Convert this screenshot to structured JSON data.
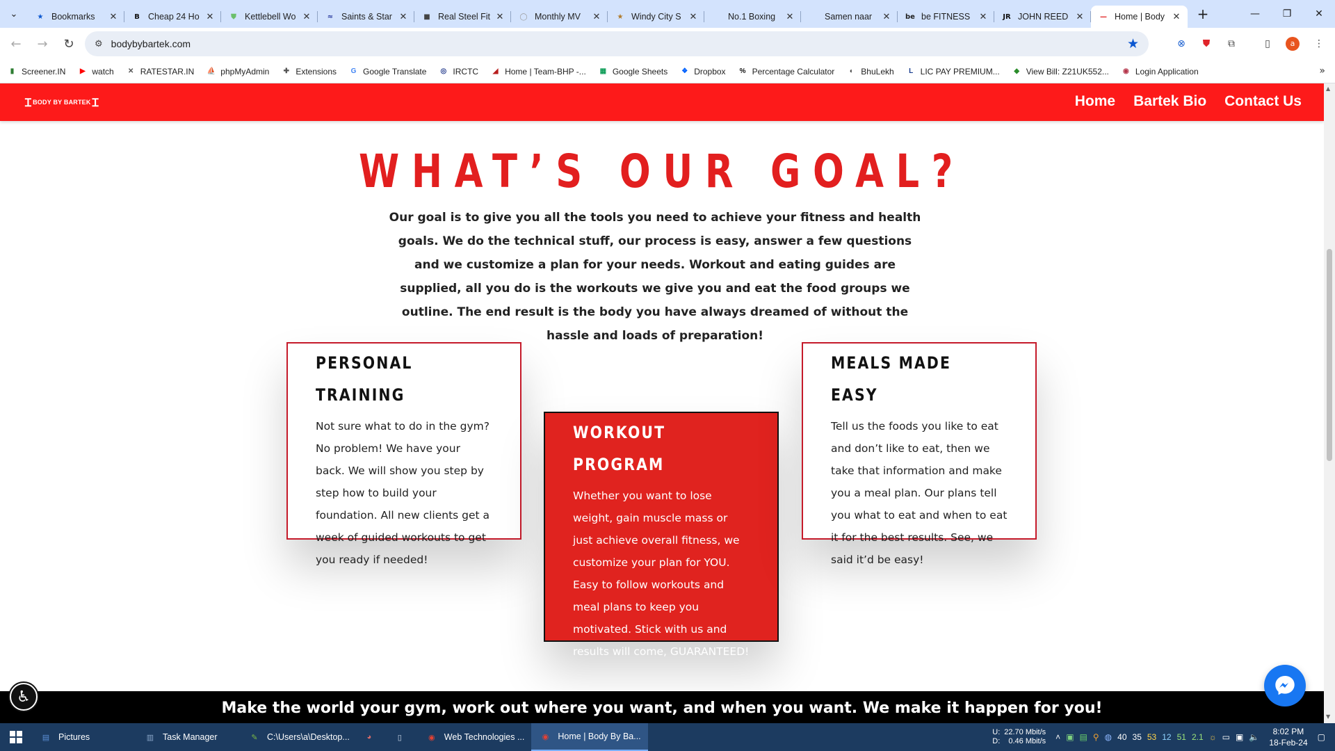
{
  "browser": {
    "tabs": [
      {
        "title": "Bookmarks",
        "icon": "star-icon",
        "color": "#0b57d0"
      },
      {
        "title": "Cheap 24 Ho",
        "icon": "b-logo-icon",
        "color": "#111111"
      },
      {
        "title": "Kettlebell Wo",
        "icon": "shield-icon",
        "color": "#6bbf6b"
      },
      {
        "title": "Saints & Star",
        "icon": "wave-icon",
        "color": "#2b3ca0"
      },
      {
        "title": "Real Steel Fit",
        "icon": "cube-icon",
        "color": "#444444"
      },
      {
        "title": "Monthly MV",
        "icon": "globe-icon",
        "color": "#999999"
      },
      {
        "title": "Windy City S",
        "icon": "star-icon",
        "color": "#b07a2a"
      },
      {
        "title": "No.1 Boxing",
        "icon": "blank-icon",
        "color": "#ffffff"
      },
      {
        "title": "Samen naar",
        "icon": "blank-icon",
        "color": "#ffffff"
      },
      {
        "title": "be FITNESS",
        "icon": "be-logo-icon",
        "color": "#222222"
      },
      {
        "title": "JOHN REED",
        "icon": "jr-logo-icon",
        "color": "#111111"
      },
      {
        "title": "Home | Body",
        "icon": "dash-icon",
        "color": "#e01a1a"
      }
    ],
    "url": "bodybybartek.com",
    "bookmarks": [
      {
        "label": "Screener.IN",
        "color": "#2e7d32",
        "glyph": "▮"
      },
      {
        "label": "watch",
        "color": "#ff0000",
        "glyph": "▶"
      },
      {
        "label": "RATESTAR.IN",
        "color": "#555555",
        "glyph": "✕"
      },
      {
        "label": "phpMyAdmin",
        "color": "#f29111",
        "glyph": "⛵"
      },
      {
        "label": "Extensions",
        "color": "#555555",
        "glyph": "✚"
      },
      {
        "label": "Google Translate",
        "color": "#4285f4",
        "glyph": "G"
      },
      {
        "label": "IRCTC",
        "color": "#233a8c",
        "glyph": "◎"
      },
      {
        "label": "Home | Team-BHP -...",
        "color": "#b71c1c",
        "glyph": "◢"
      },
      {
        "label": "Google Sheets",
        "color": "#0f9d58",
        "glyph": "▦"
      },
      {
        "label": "Dropbox",
        "color": "#0061fe",
        "glyph": "❖"
      },
      {
        "label": "Percentage Calculator",
        "color": "#111111",
        "glyph": "%"
      },
      {
        "label": "BhuLekh",
        "color": "#444444",
        "glyph": "◐"
      },
      {
        "label": "LIC PAY PREMIUM...",
        "color": "#1a3e8f",
        "glyph": "L"
      },
      {
        "label": "View Bill: Z21UK552...",
        "color": "#2a8c2a",
        "glyph": "◆"
      },
      {
        "label": "Login Application",
        "color": "#b5364b",
        "glyph": "◉"
      }
    ]
  },
  "site": {
    "logo_text": "BODY BY BARTEK",
    "nav": [
      "Home",
      "Bartek Bio",
      "Contact Us"
    ],
    "goal_title": "WHAT’S OUR GOAL?",
    "intro": "Our goal is to give you all the tools you need to achieve your fitness and health goals. We do the technical stuff, our process is easy, answer a few questions and we customize a plan for your needs. Workout and eating guides are supplied, all you do is the workouts we give you and eat the food groups we outline. The end result is the body you have always dreamed of without the hassle and loads of preparation!",
    "cards": [
      {
        "title": "PERSONAL TRAINING",
        "text": "Not sure what to do in the gym? No problem! We have your back. We will show you step by step how to build your foundation. All new clients get a week of guided workouts to get you ready if needed!"
      },
      {
        "title": "WORKOUT PROGRAM",
        "text": "Whether you want to lose weight, gain muscle mass or just achieve overall fitness, we customize your plan for YOU. Easy to follow workouts and meal plans to keep you motivated. Stick with us and results will come, GUARANTEED!"
      },
      {
        "title": "MEALS MADE EASY",
        "text": "Tell us the foods you like to eat and don’t like to eat, then we take that information and make you a meal plan. Our plans tell you what to eat and when to eat it for the best results. See, we said it’d be easy!"
      }
    ],
    "banner": "Make the world your gym, work out where you want, and when you want. We make it happen for you!",
    "brand_red": "#fd1a1a",
    "accent_red": "#e21f1f"
  },
  "taskbar": {
    "items": [
      {
        "label": "Pictures",
        "icon": "folder-icon",
        "color": "#5b8fd6"
      },
      {
        "label": "Task Manager",
        "icon": "task-manager-icon",
        "color": "#8aa6c8"
      },
      {
        "label": "C:\\Users\\a\\Desktop...",
        "icon": "notepad-plus-icon",
        "color": "#7dbb45"
      },
      {
        "label": "",
        "icon": "app-icon",
        "color": "#d66b6b"
      },
      {
        "label": "",
        "icon": "document-icon",
        "color": "#c8d4e4"
      },
      {
        "label": "Web Technologies ...",
        "icon": "chrome-icon",
        "color": "#e34133"
      },
      {
        "label": "Home | Body By Ba...",
        "icon": "chrome-icon",
        "color": "#e34133"
      }
    ],
    "net_up_label": "U:",
    "net_down_label": "D:",
    "net_up": "22.70 Mbit/s",
    "net_down": "0.46 Mbit/s",
    "tray_numbers": [
      "40",
      "35",
      "53",
      "12",
      "51",
      "2.1"
    ],
    "time": "8:02 PM",
    "date": "18-Feb-24"
  }
}
